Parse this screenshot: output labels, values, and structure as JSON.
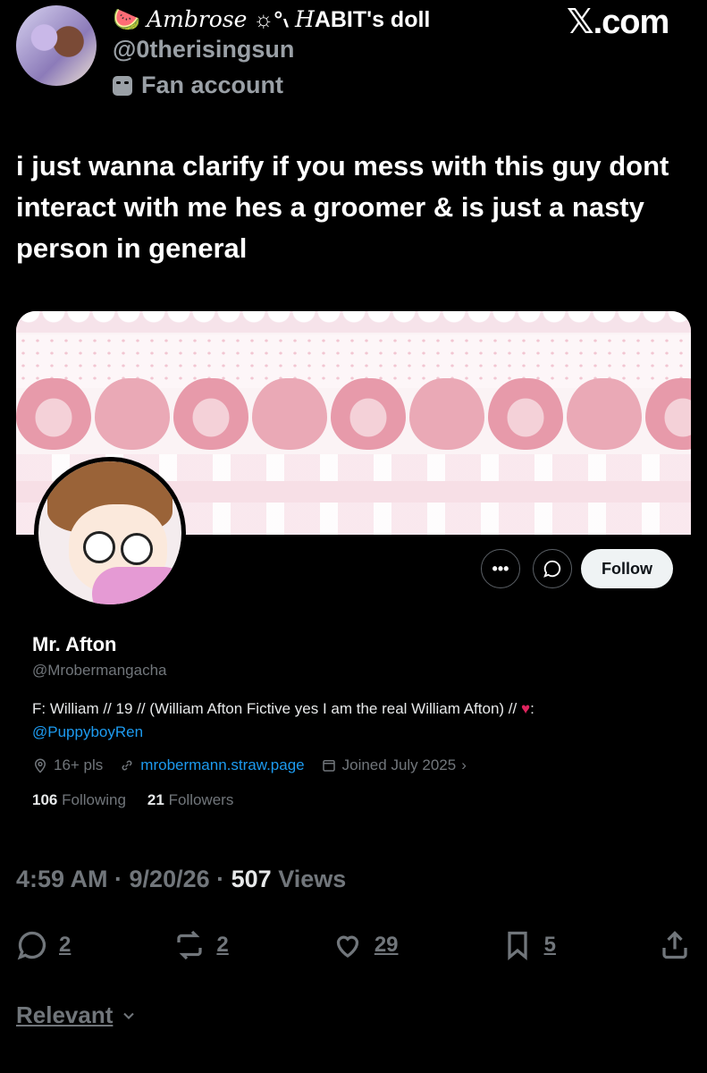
{
  "header": {
    "author_name_prefix": "🍉 ",
    "author_name_serif": "Ambrose",
    "author_name_mid": " ☼°៶ ",
    "author_name_serif2": "H",
    "author_name_suffix": "ABIT's doll",
    "handle": "@0therisingsun",
    "fan_label": "Fan account",
    "watermark": "𝕏.com"
  },
  "tweet": {
    "text": "i just wanna clarify if you mess with this guy dont interact with me hes a groomer & is just a nasty person in general"
  },
  "profile_card": {
    "more_label": "•••",
    "follow_label": "Follow",
    "name": "Mr. Afton",
    "handle": "@Mrobermangacha",
    "bio_text": "F: William // 19 // (William Afton Fictive yes I am the real William Afton) // ",
    "bio_heart": "♥",
    "bio_colon": ":",
    "bio_mention": "@PuppyboyRen",
    "location": "16+ pls",
    "website": "mrobermann.straw.page",
    "joined": "Joined July 2025",
    "following_count": "106",
    "following_label": "Following",
    "followers_count": "21",
    "followers_label": "Followers"
  },
  "meta": {
    "time": "4:59 AM",
    "sep1": " · ",
    "date": "9/20/26",
    "sep2": " · ",
    "views_count": "507",
    "views_label": " Views"
  },
  "actions": {
    "replies": "2",
    "reposts": "2",
    "likes": "29",
    "bookmarks": "5"
  },
  "sort": {
    "label": "Relevant"
  },
  "colors": {
    "background": "#000000",
    "muted": "#71767b",
    "link": "#1d9bf0"
  }
}
